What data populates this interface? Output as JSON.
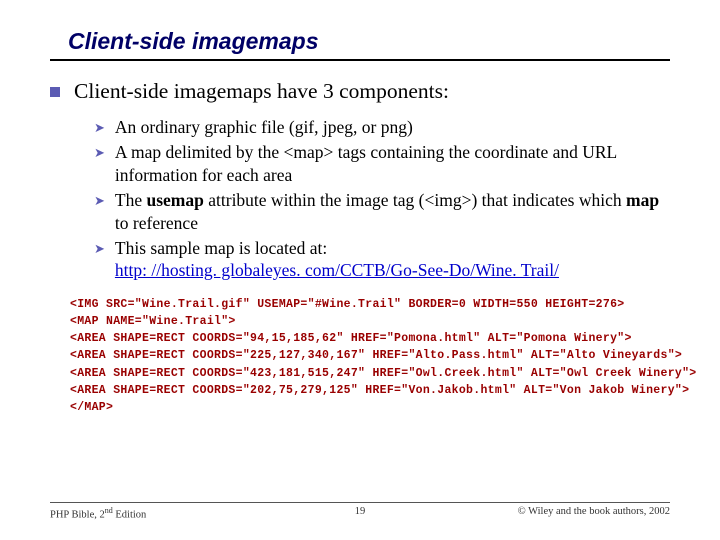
{
  "title": "Client-side imagemaps",
  "intro": "Client-side imagemaps have 3 components:",
  "items": {
    "i0": "An ordinary graphic file (gif, jpeg, or png)",
    "i1": "A map delimited by the <map> tags containing the coordinate and URL information for each area",
    "i2a": "The ",
    "i2b": "usemap",
    "i2c": " attribute within the image tag (<img>) that indicates which ",
    "i2d": "map",
    "i2e": " to reference",
    "i3a": "This sample map is located at:",
    "i3link": "http: //hosting. globaleyes. com/CCTB/Go-See-Do/Wine. Trail/"
  },
  "code": {
    "l0": "<IMG SRC=\"Wine.Trail.gif\" USEMAP=\"#Wine.Trail\" BORDER=0 WIDTH=550 HEIGHT=276>",
    "l1": "<MAP NAME=\"Wine.Trail\">",
    "l2": "<AREA SHAPE=RECT COORDS=\"94,15,185,62\" HREF=\"Pomona.html\" ALT=\"Pomona Winery\">",
    "l3": "<AREA SHAPE=RECT COORDS=\"225,127,340,167\" HREF=\"Alto.Pass.html\" ALT=\"Alto Vineyards\">",
    "l4": "<AREA SHAPE=RECT COORDS=\"423,181,515,247\" HREF=\"Owl.Creek.html\" ALT=\"Owl Creek Winery\">",
    "l5": "<AREA SHAPE=RECT COORDS=\"202,75,279,125\" HREF=\"Von.Jakob.html\" ALT=\"Von Jakob Winery\">",
    "l6": "</MAP>"
  },
  "footer": {
    "left_a": "PHP Bible, 2",
    "left_b": " Edition",
    "center": "19",
    "right": "© Wiley and the book authors, 2002"
  }
}
